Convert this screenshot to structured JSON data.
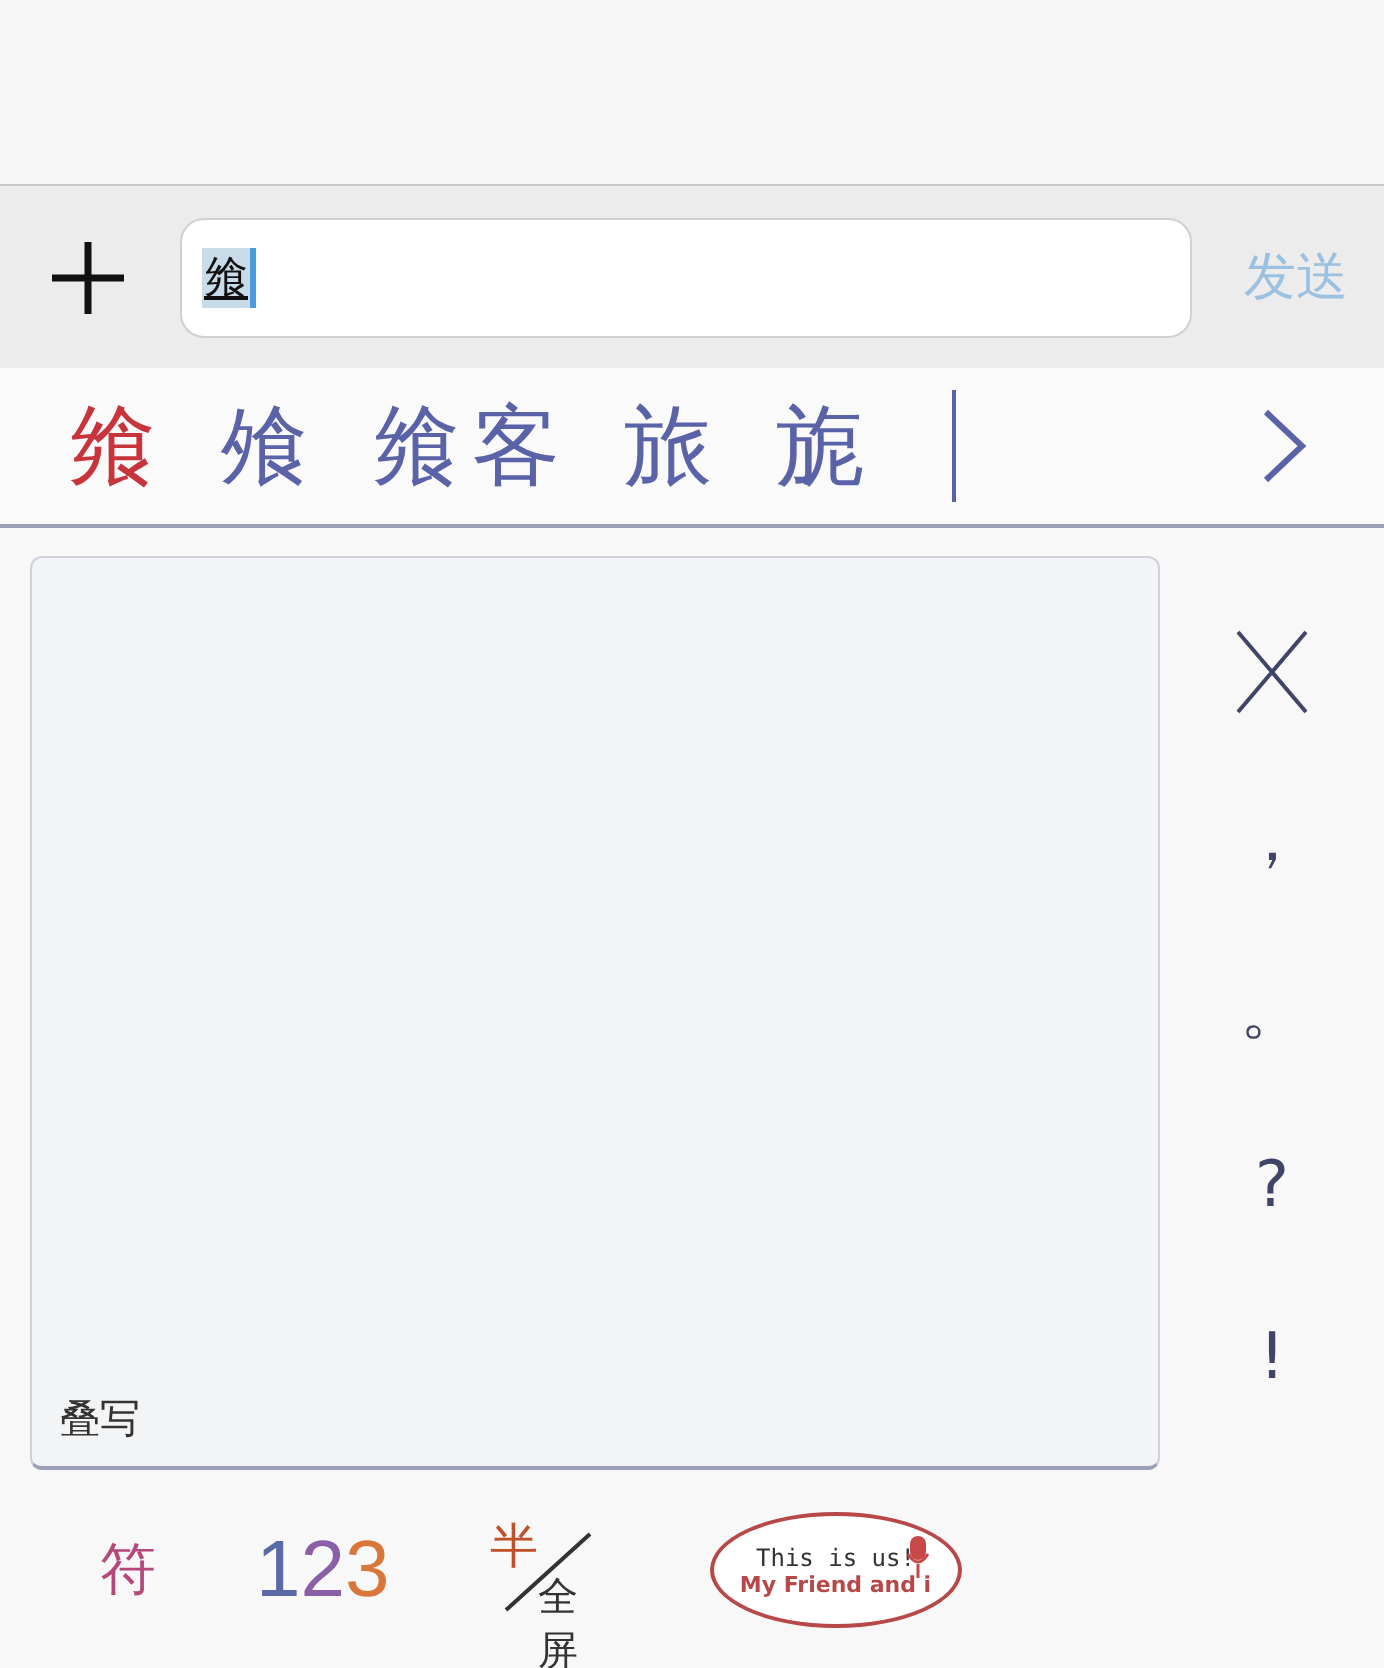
{
  "input_bar": {
    "value": "飨",
    "send_label": "发送"
  },
  "candidates": [
    {
      "text": "飨",
      "selected": true
    },
    {
      "text": "飧",
      "selected": false
    },
    {
      "text": "飨客",
      "selected": false
    },
    {
      "text": "旅",
      "selected": false
    },
    {
      "text": "旎",
      "selected": false
    }
  ],
  "handwriting_pad": {
    "mode_label": "叠写"
  },
  "punctuation": [
    "，",
    "。",
    "?",
    "!"
  ],
  "bottom_keys": [
    {
      "kind": "symbol",
      "text": "符"
    },
    {
      "kind": "digits",
      "parts": [
        {
          "text": "1",
          "color": "#5a6aa8"
        },
        {
          "text": "2",
          "color": "#8a5fa8"
        },
        {
          "text": "3",
          "color": "#d9773a"
        }
      ]
    },
    {
      "kind": "half_full",
      "half": "半",
      "full": "全屏"
    },
    {
      "kind": "sticker",
      "line_1": "This is us!",
      "line_2": "My Friend and i"
    }
  ]
}
